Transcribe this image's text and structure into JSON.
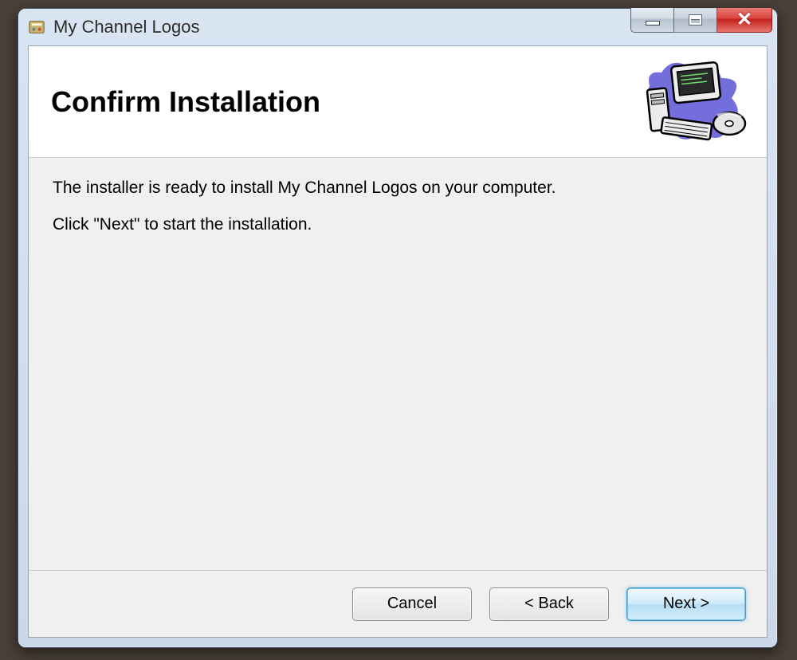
{
  "window": {
    "title": "My Channel Logos"
  },
  "banner": {
    "heading": "Confirm Installation"
  },
  "body": {
    "line1": "The installer is ready to install My Channel Logos on your computer.",
    "line2": "Click \"Next\" to start the installation."
  },
  "buttons": {
    "cancel": "Cancel",
    "back": "< Back",
    "next": "Next >"
  }
}
